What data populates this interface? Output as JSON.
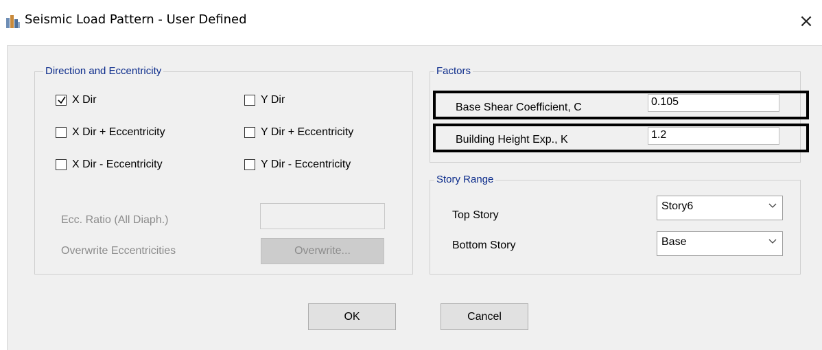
{
  "window": {
    "title": "Seismic Load Pattern - User Defined",
    "close_glyph": "×",
    "app_icon": "etabs-app-icon"
  },
  "direction_group": {
    "title": "Direction and Eccentricity",
    "checkboxes": [
      {
        "label": "X Dir",
        "checked": true
      },
      {
        "label": "X Dir + Eccentricity",
        "checked": false
      },
      {
        "label": "X Dir - Eccentricity",
        "checked": false
      },
      {
        "label": "Y Dir",
        "checked": false
      },
      {
        "label": "Y Dir + Eccentricity",
        "checked": false
      },
      {
        "label": "Y Dir - Eccentricity",
        "checked": false
      }
    ],
    "ecc_ratio_label": "Ecc. Ratio (All Diaph.)",
    "ecc_ratio_value": "",
    "overwrite_label": "Overwrite Eccentricities",
    "overwrite_button": "Overwrite..."
  },
  "factors_group": {
    "title": "Factors",
    "base_shear_label": "Base Shear Coefficient, C",
    "base_shear_value": "0.105",
    "height_exp_label": "Building Height Exp., K",
    "height_exp_value": "1.2"
  },
  "story_range_group": {
    "title": "Story Range",
    "top_story_label": "Top Story",
    "top_story_value": "Story6",
    "bottom_story_label": "Bottom Story",
    "bottom_story_value": "Base"
  },
  "buttons": {
    "ok": "OK",
    "cancel": "Cancel"
  },
  "colors": {
    "group_title": "#0a2a8a",
    "dialog_bg": "#f0f0f0",
    "highlight_border": "#000000"
  }
}
